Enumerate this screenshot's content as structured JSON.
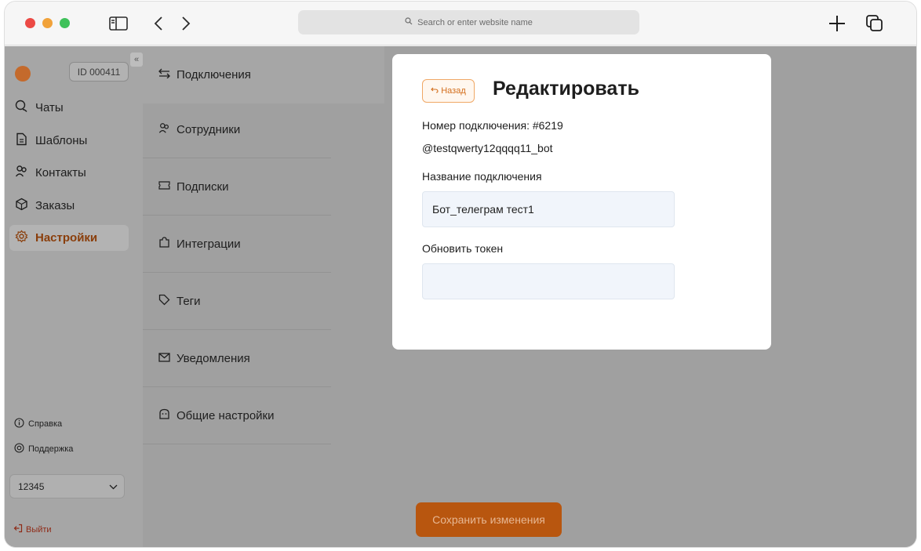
{
  "browser": {
    "address_placeholder": "Search or enter website name"
  },
  "sidebar": {
    "account_id": "ID 000411",
    "collapse_glyph": "«",
    "items": [
      {
        "label": "Чаты",
        "icon": "chat-icon"
      },
      {
        "label": "Шаблоны",
        "icon": "document-icon"
      },
      {
        "label": "Контакты",
        "icon": "people-icon"
      },
      {
        "label": "Заказы",
        "icon": "box-icon"
      },
      {
        "label": "Настройки",
        "icon": "gear-icon",
        "active": true
      }
    ],
    "help_label": "Справка",
    "support_label": "Поддержка",
    "select_value": "12345",
    "logout_label": "Выйти"
  },
  "settings_nav": {
    "items": [
      {
        "label": "Подключения",
        "icon": "swap-icon",
        "active": true
      },
      {
        "label": "Сотрудники",
        "icon": "people-icon"
      },
      {
        "label": "Подписки",
        "icon": "ticket-icon"
      },
      {
        "label": "Интеграции",
        "icon": "puzzle-icon"
      },
      {
        "label": "Теги",
        "icon": "tag-icon"
      },
      {
        "label": "Уведомления",
        "icon": "mail-icon"
      },
      {
        "label": "Общие настройки",
        "icon": "settings-icon"
      }
    ]
  },
  "modal": {
    "back_label": "Назад",
    "title": "Редактировать",
    "connection_number": "Номер подключения: #6219",
    "bot_handle": "@testqwerty12qqqq11_bot",
    "name_label": "Название подключения",
    "name_value": "Бот_телеграм тест1",
    "token_label": "Обновить токен",
    "token_value": ""
  },
  "footer": {
    "save_label": "Сохранить изменения"
  },
  "colors": {
    "accent": "#d36e1c",
    "save_button": "#b8560f",
    "overlay": "#a0a0a0"
  }
}
